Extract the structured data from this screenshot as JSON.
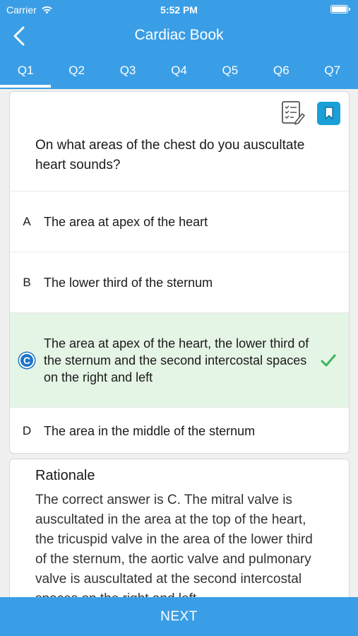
{
  "status": {
    "carrier": "Carrier",
    "time": "5:52 PM"
  },
  "nav": {
    "title": "Cardiac Book"
  },
  "tabs": [
    {
      "label": "Q1",
      "active": true
    },
    {
      "label": "Q2"
    },
    {
      "label": "Q3"
    },
    {
      "label": "Q4"
    },
    {
      "label": "Q5"
    },
    {
      "label": "Q6"
    },
    {
      "label": "Q7"
    }
  ],
  "question": {
    "text": "On what areas of the chest do you auscultate heart sounds?"
  },
  "options": [
    {
      "letter": "A",
      "text": "The area at apex of the heart"
    },
    {
      "letter": "B",
      "text": "The lower third of the sternum"
    },
    {
      "letter": "C",
      "text": "The area at apex of the heart, the lower third of the sternum and the second intercostal spaces on the right and left"
    },
    {
      "letter": "D",
      "text": "The area in the middle of the sternum"
    }
  ],
  "rationale": {
    "title": "Rationale",
    "text": "The correct answer is C. The mitral valve is auscultated in the area at the top of the heart, the tricuspid valve in the area of the lower third of the sternum, the aortic valve and pulmonary valve is auscultated at the second intercostal spaces on the right and left."
  },
  "footer": {
    "next_label": "NEXT"
  },
  "colors": {
    "primary": "#3a9ee6",
    "correct_bg": "#e4f4e5",
    "check": "#3cb55a",
    "bookmark": "#1a9fd6"
  },
  "icons": {
    "back": "chevron-left-icon",
    "notes": "notes-checklist-icon",
    "bookmark": "bookmark-icon",
    "check": "checkmark-icon",
    "wifi": "wifi-icon",
    "battery": "battery-icon"
  }
}
